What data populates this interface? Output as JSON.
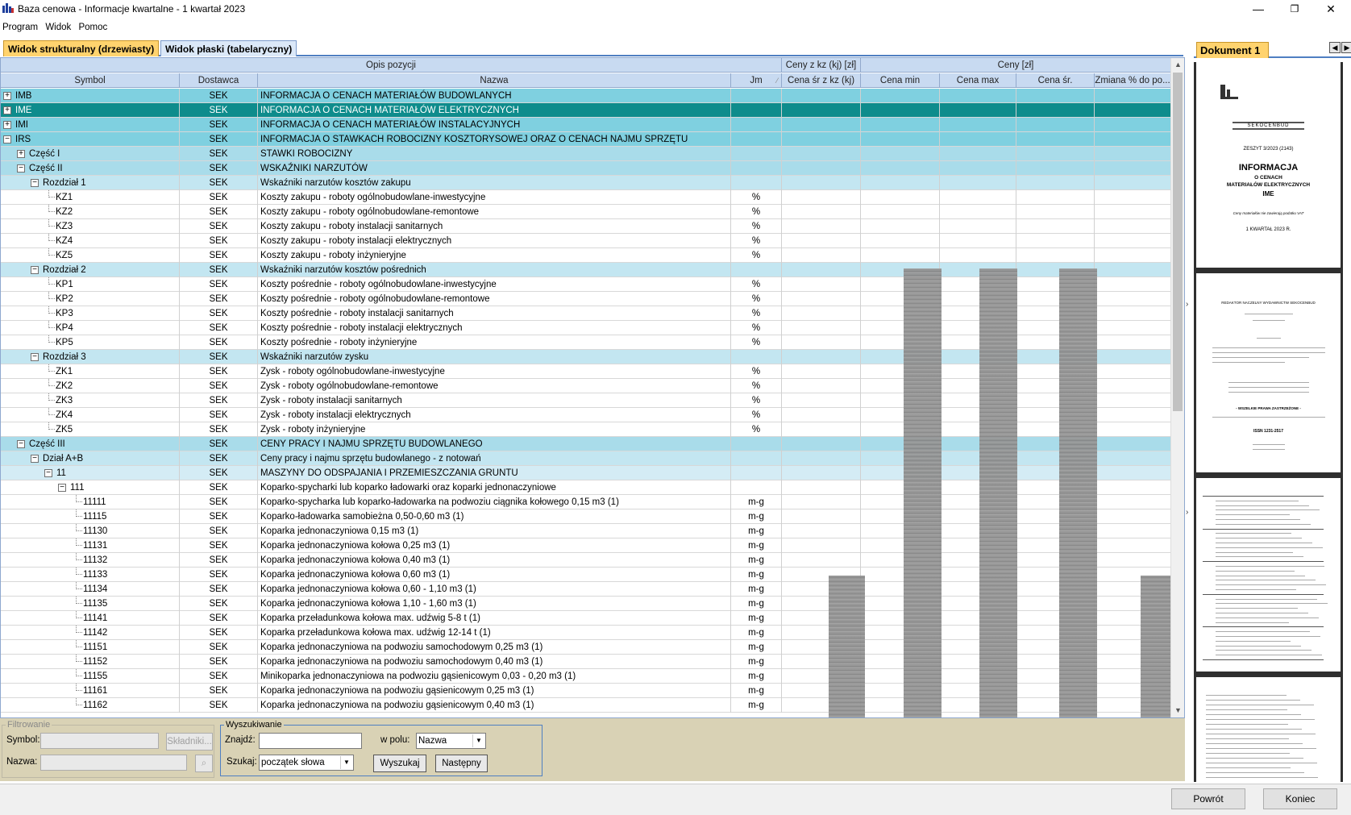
{
  "window": {
    "title": "Baza cenowa - Informacje kwartalne - 1 kwartał 2023"
  },
  "menu": [
    "Program",
    "Widok",
    "Pomoc"
  ],
  "tabs": [
    {
      "label": "Widok strukturalny (drzewiasty)",
      "active": true
    },
    {
      "label": "Widok płaski (tabelaryczny)",
      "active": false
    }
  ],
  "grid": {
    "header_groups": {
      "opis": "Opis pozycji",
      "ceny_kz": "Ceny z kz (kj) [zł]",
      "ceny": "Ceny [zł]"
    },
    "columns": {
      "symbol": "Symbol",
      "dostawca": "Dostawca",
      "nazwa": "Nazwa",
      "jm": "Jm",
      "cena_sr_kz": "Cena śr z kz (kj)",
      "cena_min": "Cena min",
      "cena_max": "Cena max",
      "cena_sr": "Cena śr.",
      "zmiana": "Zmiana % do po..."
    },
    "rows": [
      {
        "symbol": "IMB",
        "dostawca": "SEK",
        "nazwa": "INFORMACJA O CENACH MATERIAŁÓW BUDOWLANYCH",
        "jm": "",
        "level": 0,
        "toggle": "+"
      },
      {
        "symbol": "IME",
        "dostawca": "SEK",
        "nazwa": "INFORMACJA O CENACH MATERIAŁÓW ELEKTRYCZNYCH",
        "jm": "",
        "level": 0,
        "toggle": "+",
        "selected": true
      },
      {
        "symbol": "IMI",
        "dostawca": "SEK",
        "nazwa": "INFORMACJA O CENACH MATERIAŁÓW INSTALACYJNYCH",
        "jm": "",
        "level": 0,
        "toggle": "+"
      },
      {
        "symbol": "IRS",
        "dostawca": "SEK",
        "nazwa": "INFORMACJA O STAWKACH ROBOCIZNY KOSZTORYSOWEJ ORAZ O CENACH NAJMU SPRZĘTU",
        "jm": "",
        "level": 0,
        "toggle": "-"
      },
      {
        "symbol": "Część I",
        "dostawca": "SEK",
        "nazwa": "STAWKI ROBOCIZNY",
        "jm": "",
        "level": 1,
        "toggle": "+"
      },
      {
        "symbol": "Część II",
        "dostawca": "SEK",
        "nazwa": "WSKAŹNIKI NARZUTÓW",
        "jm": "",
        "level": 1,
        "toggle": "-"
      },
      {
        "symbol": "Rozdział 1",
        "dostawca": "SEK",
        "nazwa": "Wskaźniki narzutów kosztów zakupu",
        "jm": "",
        "level": 2,
        "toggle": "-"
      },
      {
        "symbol": "KZ1",
        "dostawca": "SEK",
        "nazwa": "Koszty zakupu - roboty ogólnobudowlane-inwestycyjne",
        "jm": "%",
        "level": 3
      },
      {
        "symbol": "KZ2",
        "dostawca": "SEK",
        "nazwa": "Koszty zakupu - roboty ogólnobudowlane-remontowe",
        "jm": "%",
        "level": 3
      },
      {
        "symbol": "KZ3",
        "dostawca": "SEK",
        "nazwa": "Koszty zakupu - roboty instalacji sanitarnych",
        "jm": "%",
        "level": 3
      },
      {
        "symbol": "KZ4",
        "dostawca": "SEK",
        "nazwa": "Koszty zakupu - roboty instalacji elektrycznych",
        "jm": "%",
        "level": 3
      },
      {
        "symbol": "KZ5",
        "dostawca": "SEK",
        "nazwa": "Koszty zakupu - roboty inżynieryjne",
        "jm": "%",
        "level": 3
      },
      {
        "symbol": "Rozdział 2",
        "dostawca": "SEK",
        "nazwa": "Wskaźniki narzutów kosztów pośrednich",
        "jm": "",
        "level": 2,
        "toggle": "-"
      },
      {
        "symbol": "KP1",
        "dostawca": "SEK",
        "nazwa": "Koszty pośrednie - roboty ogólnobudowlane-inwestycyjne",
        "jm": "%",
        "level": 3
      },
      {
        "symbol": "KP2",
        "dostawca": "SEK",
        "nazwa": "Koszty pośrednie - roboty ogólnobudowlane-remontowe",
        "jm": "%",
        "level": 3
      },
      {
        "symbol": "KP3",
        "dostawca": "SEK",
        "nazwa": "Koszty pośrednie - roboty instalacji sanitarnych",
        "jm": "%",
        "level": 3
      },
      {
        "symbol": "KP4",
        "dostawca": "SEK",
        "nazwa": "Koszty pośrednie - roboty instalacji elektrycznych",
        "jm": "%",
        "level": 3
      },
      {
        "symbol": "KP5",
        "dostawca": "SEK",
        "nazwa": "Koszty pośrednie - roboty inżynieryjne",
        "jm": "%",
        "level": 3
      },
      {
        "symbol": "Rozdział 3",
        "dostawca": "SEK",
        "nazwa": "Wskaźniki narzutów zysku",
        "jm": "",
        "level": 2,
        "toggle": "-"
      },
      {
        "symbol": "ZK1",
        "dostawca": "SEK",
        "nazwa": "Zysk - roboty ogólnobudowlane-inwestycyjne",
        "jm": "%",
        "level": 3
      },
      {
        "symbol": "ZK2",
        "dostawca": "SEK",
        "nazwa": "Zysk - roboty ogólnobudowlane-remontowe",
        "jm": "%",
        "level": 3
      },
      {
        "symbol": "ZK3",
        "dostawca": "SEK",
        "nazwa": "Zysk - roboty instalacji sanitarnych",
        "jm": "%",
        "level": 3
      },
      {
        "symbol": "ZK4",
        "dostawca": "SEK",
        "nazwa": "Zysk - roboty instalacji elektrycznych",
        "jm": "%",
        "level": 3
      },
      {
        "symbol": "ZK5",
        "dostawca": "SEK",
        "nazwa": "Zysk - roboty inżynieryjne",
        "jm": "%",
        "level": 3
      },
      {
        "symbol": "Część III",
        "dostawca": "SEK",
        "nazwa": "CENY PRACY I NAJMU SPRZĘTU BUDOWLANEGO",
        "jm": "",
        "level": 1,
        "toggle": "-"
      },
      {
        "symbol": "Dział A+B",
        "dostawca": "SEK",
        "nazwa": "Ceny pracy i najmu sprzętu budowlanego - z notowań",
        "jm": "",
        "level": 2,
        "toggle": "-"
      },
      {
        "symbol": "11",
        "dostawca": "SEK",
        "nazwa": "MASZYNY DO ODSPAJANIA I PRZEMIESZCZANIA GRUNTU",
        "jm": "",
        "level": 3,
        "toggle": "-"
      },
      {
        "symbol": "111",
        "dostawca": "SEK",
        "nazwa": "Koparko-spycharki lub koparko ładowarki oraz koparki jednonaczyniowe",
        "jm": "",
        "level": 4,
        "toggle": "-"
      },
      {
        "symbol": "11111",
        "dostawca": "SEK",
        "nazwa": "Koparko-spycharka lub koparko-ładowarka na podwoziu ciągnika kołowego 0,15 m3 (1)",
        "jm": "m-g",
        "level": 5
      },
      {
        "symbol": "11115",
        "dostawca": "SEK",
        "nazwa": "Koparko-ładowarka samobieżna 0,50-0,60 m3 (1)",
        "jm": "m-g",
        "level": 5
      },
      {
        "symbol": "11130",
        "dostawca": "SEK",
        "nazwa": "Koparka jednonaczyniowa 0,15 m3 (1)",
        "jm": "m-g",
        "level": 5
      },
      {
        "symbol": "11131",
        "dostawca": "SEK",
        "nazwa": "Koparka jednonaczyniowa kołowa 0,25 m3 (1)",
        "jm": "m-g",
        "level": 5
      },
      {
        "symbol": "11132",
        "dostawca": "SEK",
        "nazwa": "Koparka jednonaczyniowa kołowa 0,40 m3 (1)",
        "jm": "m-g",
        "level": 5
      },
      {
        "symbol": "11133",
        "dostawca": "SEK",
        "nazwa": "Koparka jednonaczyniowa kołowa 0,60 m3 (1)",
        "jm": "m-g",
        "level": 5
      },
      {
        "symbol": "11134",
        "dostawca": "SEK",
        "nazwa": "Koparka jednonaczyniowa kołowa 0,60 - 1,10 m3 (1)",
        "jm": "m-g",
        "level": 5
      },
      {
        "symbol": "11135",
        "dostawca": "SEK",
        "nazwa": "Koparka jednonaczyniowa kołowa 1,10 - 1,60 m3 (1)",
        "jm": "m-g",
        "level": 5
      },
      {
        "symbol": "11141",
        "dostawca": "SEK",
        "nazwa": "Koparka przeładunkowa kołowa max. udźwig 5-8 t (1)",
        "jm": "m-g",
        "level": 5
      },
      {
        "symbol": "11142",
        "dostawca": "SEK",
        "nazwa": "Koparka przeładunkowa kołowa max. udźwig 12-14 t (1)",
        "jm": "m-g",
        "level": 5
      },
      {
        "symbol": "11151",
        "dostawca": "SEK",
        "nazwa": "Koparka jednonaczyniowa na podwoziu samochodowym 0,25 m3 (1)",
        "jm": "m-g",
        "level": 5
      },
      {
        "symbol": "11152",
        "dostawca": "SEK",
        "nazwa": "Koparka jednonaczyniowa na podwoziu samochodowym 0,40 m3 (1)",
        "jm": "m-g",
        "level": 5
      },
      {
        "symbol": "11155",
        "dostawca": "SEK",
        "nazwa": "Minikoparka jednonaczyniowa na podwoziu gąsienicowym 0,03 - 0,20 m3 (1)",
        "jm": "m-g",
        "level": 5
      },
      {
        "symbol": "11161",
        "dostawca": "SEK",
        "nazwa": "Koparka jednonaczyniowa na podwoziu gąsienicowym 0,25 m3 (1)",
        "jm": "m-g",
        "level": 5
      },
      {
        "symbol": "11162",
        "dostawca": "SEK",
        "nazwa": "Koparka jednonaczyniowa na podwoziu gąsienicowym 0,40 m3 (1)",
        "jm": "m-g",
        "level": 5
      }
    ]
  },
  "filter": {
    "legend": "Filtrowanie",
    "symbol_label": "Symbol:",
    "nazwa_label": "Nazwa:",
    "sklad_button": "Składniki...",
    "go_button": "⌕"
  },
  "search": {
    "legend": "Wyszukiwanie",
    "znajdz_label": "Znajdź:",
    "znajdz_value": "",
    "wpolu_label": "w polu:",
    "wpolu_value": "Nazwa",
    "szukaj_label": "Szukaj:",
    "szukaj_value": "początek słowa",
    "search_button": "Wyszukaj",
    "next_button": "Następny"
  },
  "document": {
    "tab": "Dokument 1",
    "cover": {
      "publisher": "SEKOCENBUD",
      "issue": "ZESZYT 3/2023 (2143)",
      "title": "INFORMACJA",
      "subtitle1": "O CENACH",
      "subtitle2": "MATERIAŁÓW ELEKTRYCZNYCH",
      "code": "IME",
      "note": "Ceny materiałów nie zawierają podatku VAT",
      "quarter": "1 KWARTAŁ 2023 R."
    },
    "page2": {
      "line1": "REDAKTOR NACZELNY WYDAWNICTW SEKOCENBUD",
      "rights": "- WSZELKIE PRAWA ZASTRZEŻONE -",
      "issn": "ISSN 1231-2517"
    }
  },
  "footer": {
    "back_button": "Powrót",
    "end_button": "Koniec"
  }
}
